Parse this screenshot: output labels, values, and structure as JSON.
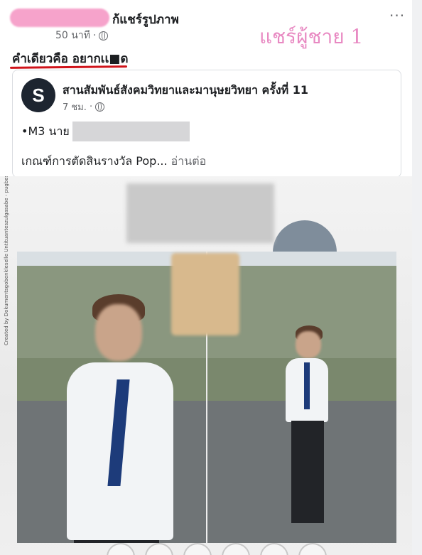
{
  "post": {
    "poster_suffix": "ก้แชร์รูปภาพ",
    "time": "50 นาที",
    "time_sep": "·",
    "more": "···",
    "annotation": "แชร์ผู้ชาย 1",
    "caption": "คำเดียวคือ อยากเเ■ด"
  },
  "shared": {
    "avatar_letter": "S",
    "page_name": "สานสัมพันธ์สังคมวิทยาและมานุษยวิทยา ครั้งที่ 11",
    "time": "7 ชม.",
    "time_sep": "·",
    "line1_prefix": "•M3 นาย",
    "line2": "เกณฑ์การตัดสินรางวัล Pop...",
    "read_more": "อ่านต่อ"
  },
  "photo": {
    "watermark": "Created by Dokumentsgobenkleselle Untituanteszulgasabe - pugbes.com"
  },
  "colors": {
    "annotation": "#e889c2",
    "underline": "#d0131a",
    "tie": "#1d3b7a"
  },
  "icons": [
    "globe-icon",
    "more-icon"
  ]
}
